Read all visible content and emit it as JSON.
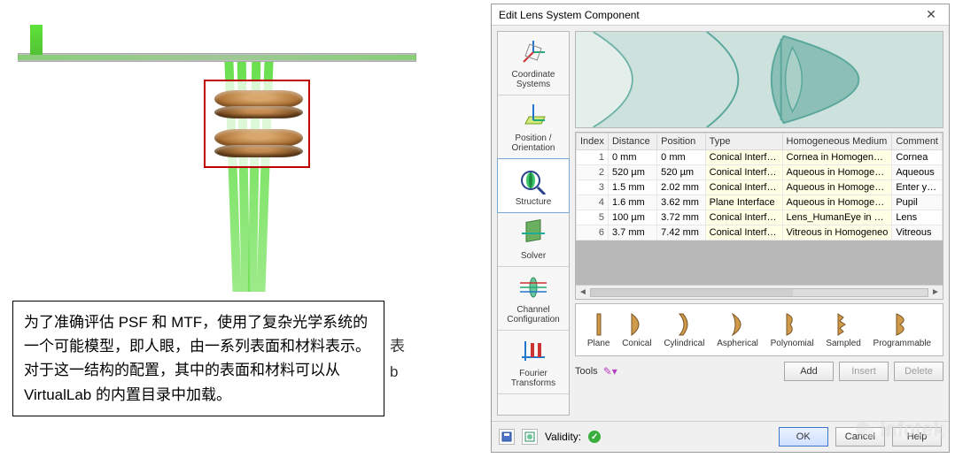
{
  "caption": {
    "text": "为了准确评估 PSF 和 MTF，使用了复杂光学系统的一个可能模型，即人眼，由一系列表面和材料表示。 对于这一结构的配置，其中的表面和材料可以从 VirtualLab 的内置目录中加载。"
  },
  "behind_fragments": {
    "line1": "表",
    "line2": "b"
  },
  "dialog": {
    "title": "Edit Lens System Component",
    "tabs": {
      "coord": "Coordinate Systems",
      "position": "Position / Orientation",
      "structure": "Structure",
      "solver": "Solver",
      "channel": "Channel Configuration",
      "fourier": "Fourier Transforms"
    },
    "table": {
      "headers": {
        "index": "Index",
        "distance": "Distance",
        "position": "Position",
        "type": "Type",
        "medium": "Homogeneous Medium",
        "comment": "Comment"
      },
      "rows": [
        {
          "index": "1",
          "distance": "0 mm",
          "position": "0 mm",
          "type": "Conical Interface",
          "medium": "Cornea in Homogeneous",
          "comment": "Cornea"
        },
        {
          "index": "2",
          "distance": "520 µm",
          "position": "520 µm",
          "type": "Conical Interface",
          "medium": "Aqueous in Homogeneo",
          "comment": "Aqueous"
        },
        {
          "index": "3",
          "distance": "1.5 mm",
          "position": "2.02 mm",
          "type": "Conical Interface",
          "medium": "Aqueous in Homogeneo",
          "comment": "Enter your comm"
        },
        {
          "index": "4",
          "distance": "1.6 mm",
          "position": "3.62 mm",
          "type": "Plane Interface",
          "medium": "Aqueous in Homogeneo",
          "comment": "Pupil"
        },
        {
          "index": "5",
          "distance": "100 µm",
          "position": "3.72 mm",
          "type": "Conical Interface",
          "medium": "Lens_HumanEye in Hom",
          "comment": "Lens"
        },
        {
          "index": "6",
          "distance": "3.7 mm",
          "position": "7.42 mm",
          "type": "Conical Interface",
          "medium": "Vitreous in Homogeneo",
          "comment": "Vitreous"
        }
      ]
    },
    "gallery": {
      "plane": "Plane",
      "conical": "Conical",
      "cylindrical": "Cylindrical",
      "aspherical": "Aspherical",
      "polynomial": "Polynomial",
      "sampled": "Sampled",
      "programmable": "Programmable"
    },
    "tools_label": "Tools",
    "buttons": {
      "add": "Add",
      "insert": "Insert",
      "delete": "Delete",
      "ok": "OK",
      "cancel": "Cancel",
      "help": "Help"
    },
    "validity_label": "Validity:"
  },
  "watermark": "infotek"
}
